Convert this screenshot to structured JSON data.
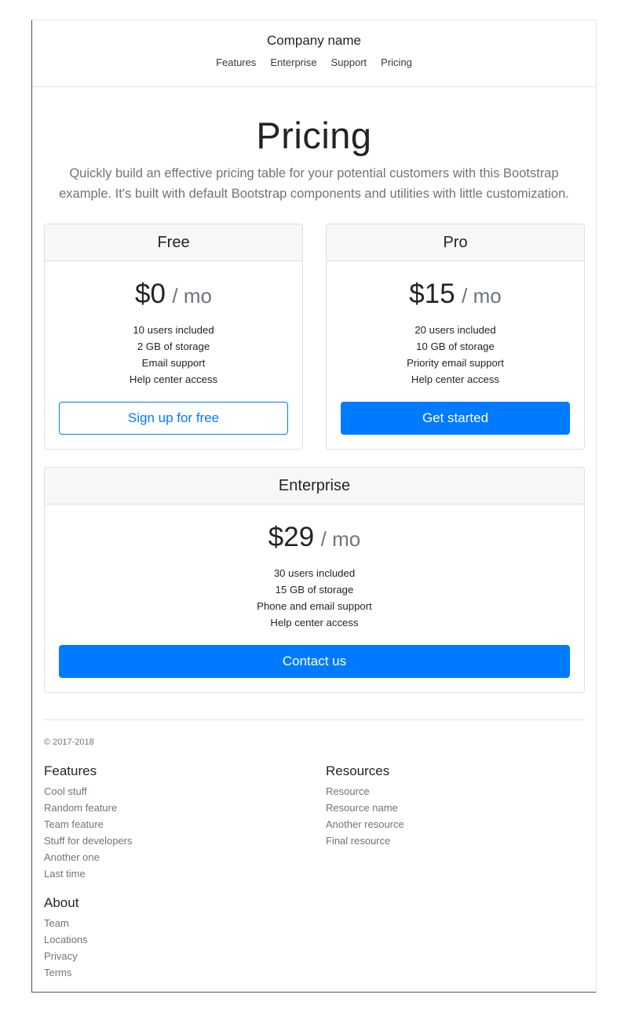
{
  "header": {
    "brand": "Company name",
    "nav": [
      "Features",
      "Enterprise",
      "Support",
      "Pricing"
    ]
  },
  "hero": {
    "title": "Pricing",
    "lead": "Quickly build an effective pricing table for your potential customers with this Bootstrap example. It's built with default Bootstrap components and utilities with little customization."
  },
  "plans": [
    {
      "name": "Free",
      "amount": "$0",
      "per": "/ mo",
      "features": [
        "10 users included",
        "2 GB of storage",
        "Email support",
        "Help center access"
      ],
      "button": "Sign up for free",
      "button_style": "outline"
    },
    {
      "name": "Pro",
      "amount": "$15",
      "per": "/ mo",
      "features": [
        "20 users included",
        "10 GB of storage",
        "Priority email support",
        "Help center access"
      ],
      "button": "Get started",
      "button_style": "solid"
    },
    {
      "name": "Enterprise",
      "amount": "$29",
      "per": "/ mo",
      "features": [
        "30 users included",
        "15 GB of storage",
        "Phone and email support",
        "Help center access"
      ],
      "button": "Contact us",
      "button_style": "solid"
    }
  ],
  "footer": {
    "copyright": "© 2017-2018",
    "features": {
      "title": "Features",
      "links": [
        "Cool stuff",
        "Random feature",
        "Team feature",
        "Stuff for developers",
        "Another one",
        "Last time"
      ]
    },
    "resources": {
      "title": "Resources",
      "links": [
        "Resource",
        "Resource name",
        "Another resource",
        "Final resource"
      ]
    },
    "about": {
      "title": "About",
      "links": [
        "Team",
        "Locations",
        "Privacy",
        "Terms"
      ]
    }
  },
  "colors": {
    "primary": "#007bff",
    "muted": "#6c757d",
    "card_header_bg": "#f7f7f7"
  }
}
